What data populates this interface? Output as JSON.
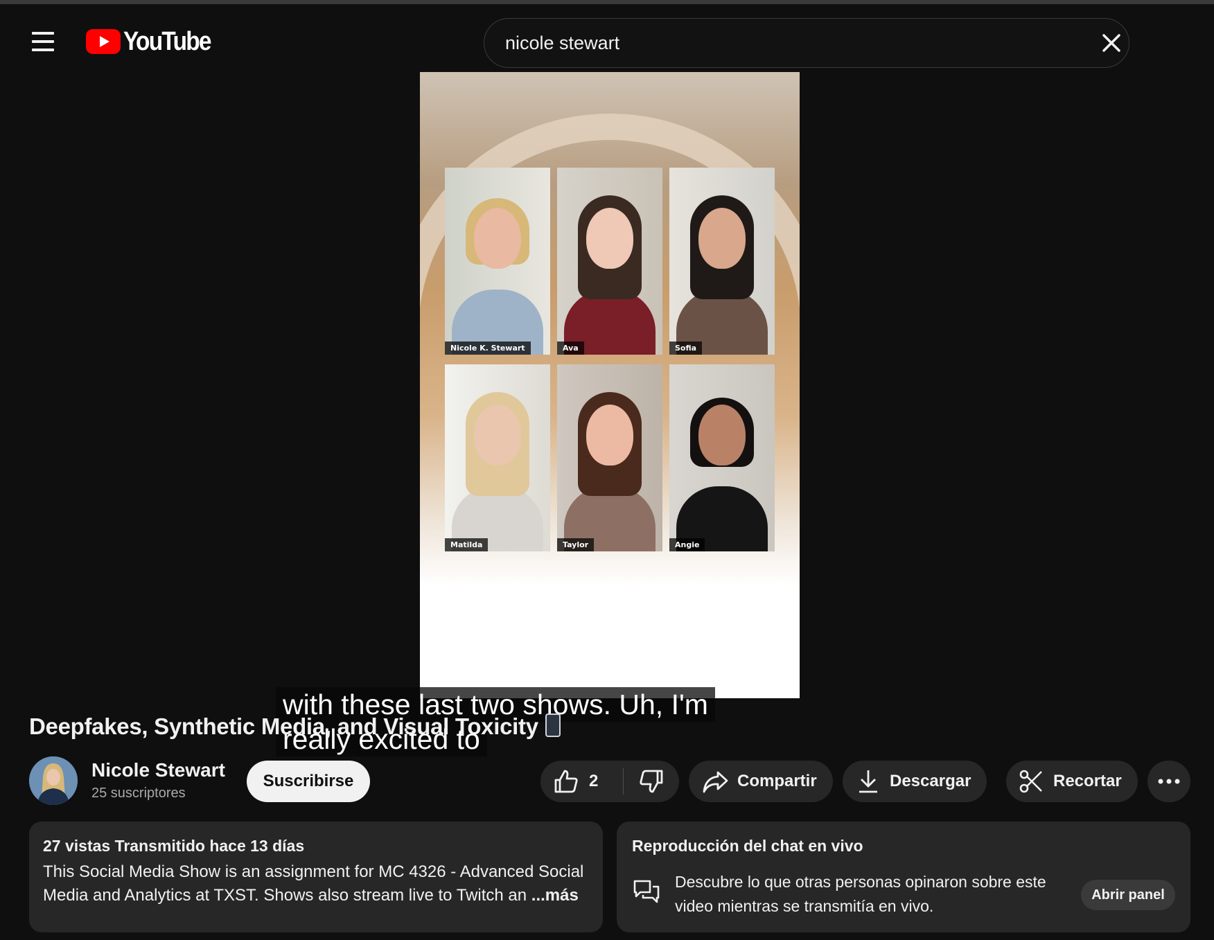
{
  "header": {
    "logo_text": "YouTube",
    "search_value": "nicole stewart",
    "icons": [
      "menu-icon",
      "youtube-play-icon",
      "close-icon",
      "search-icon"
    ],
    "colors": {
      "brand_red": "#ff0000",
      "background": "#0f0f0f",
      "pill": "#272727"
    }
  },
  "video": {
    "participants": [
      "Nicole K. Stewart",
      "Ava",
      "Sofia",
      "Matilda",
      "Taylor",
      "Angie"
    ],
    "caption_line1": "with these last two shows. Uh, I'm",
    "caption_line2": "really excited to"
  },
  "watch": {
    "title": "Deepfakes, Synthetic Media, and Visual Toxicity",
    "title_emoji": "mobile-phone-icon",
    "channel_name": "Nicole Stewart",
    "subscribers": "25 suscriptores",
    "subscribe_label": "Suscribirse",
    "like_count": "2",
    "share_label": "Compartir",
    "download_label": "Descargar",
    "clip_label": "Recortar"
  },
  "description": {
    "meta": "27 vistas  Transmitido hace 13 días",
    "text": "This Social Media Show is an assignment for MC 4326 - Advanced Social Media and Analytics at TXST. Shows also stream live to Twitch an",
    "more_label": "...más"
  },
  "chat_replay": {
    "heading": "Reproducción del chat en vivo",
    "body": "Descubre lo que otras personas opinaron sobre este video mientras se transmitía en vivo.",
    "button_label": "Abrir panel"
  }
}
